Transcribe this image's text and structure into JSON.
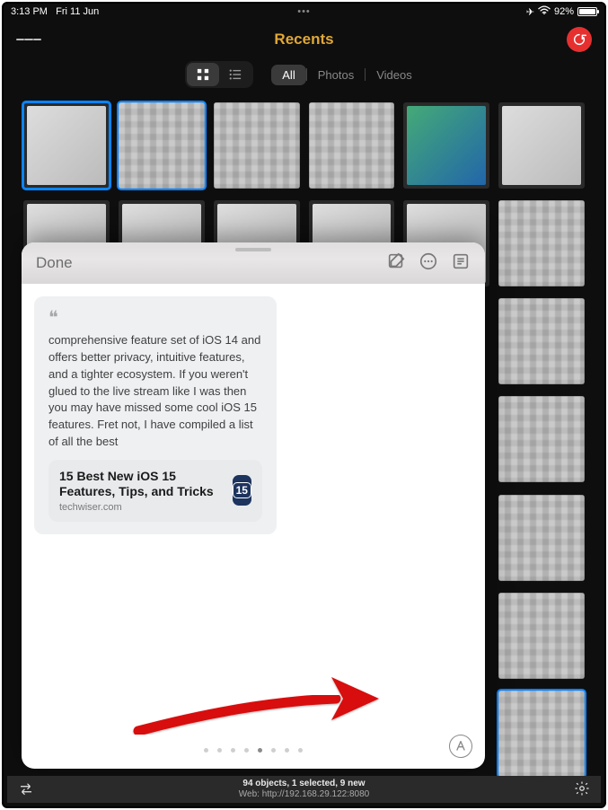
{
  "statusbar": {
    "time": "3:13 PM",
    "date": "Fri 11 Jun",
    "dots": "•••",
    "battery_pct": "92%"
  },
  "nav": {
    "title": "Recents"
  },
  "toolbar": {
    "view": {
      "grid": "grid",
      "list": "list"
    },
    "filters": {
      "all": "All",
      "photos": "Photos",
      "videos": "Videos"
    }
  },
  "sheet": {
    "done": "Done",
    "note_text": "comprehensive feature set of iOS 14 and offers better privacy, intuitive features, and a tighter ecosystem. If you weren't glued to the live stream like I was then you may have missed some cool iOS 15 features. Fret not, I have compiled a list of all the best",
    "link_title": "15 Best New iOS 15 Features, Tips, and Tricks",
    "link_source": "techwiser.com",
    "link_badge": "15",
    "corner_glyph": "A"
  },
  "bottom": {
    "status_line1": "94 objects, 1 selected, 9 new",
    "status_line2": "Web: http://192.168.29.122:8080"
  }
}
